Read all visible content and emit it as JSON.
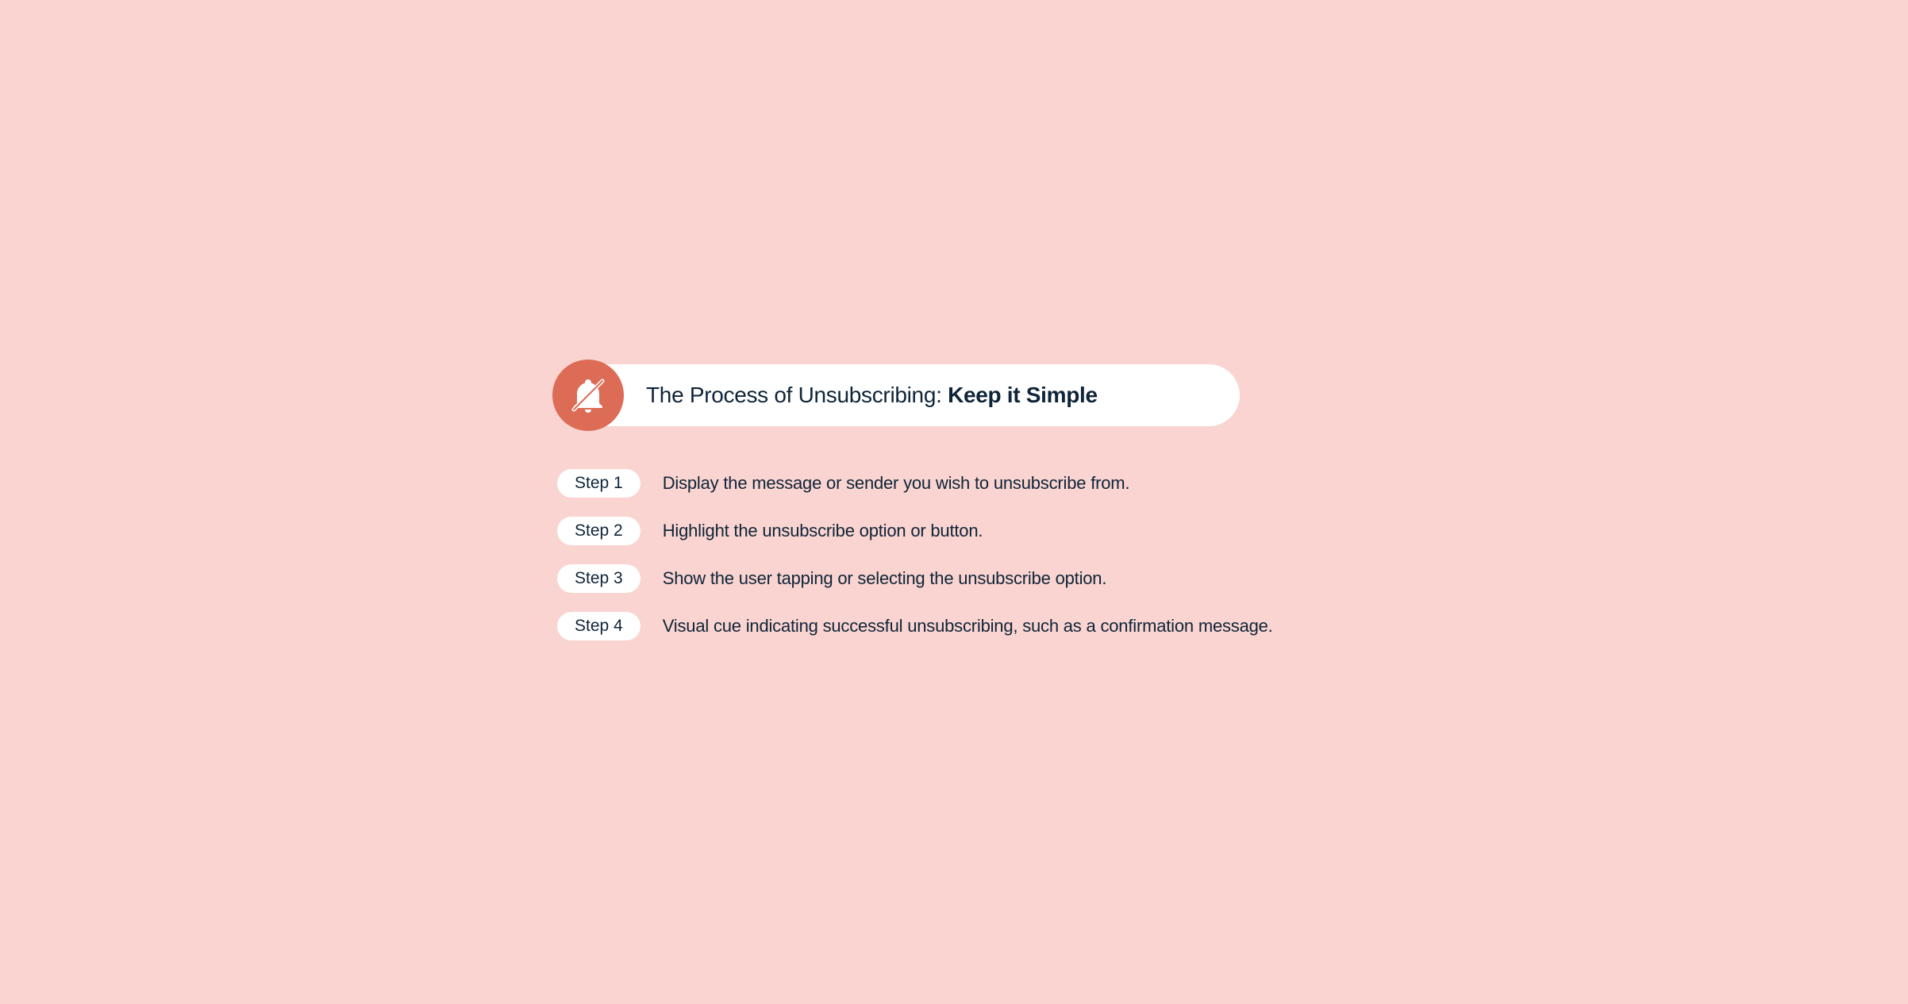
{
  "header": {
    "title_prefix": "The Process of Unsubscribing: ",
    "title_bold": "Keep it Simple",
    "icon": "bell-slash-icon"
  },
  "steps": [
    {
      "label": "Step 1",
      "text": "Display the message or sender you wish to unsubscribe from."
    },
    {
      "label": "Step 2",
      "text": "Highlight the unsubscribe option or button."
    },
    {
      "label": "Step 3",
      "text": "Show the user tapping or selecting the unsubscribe option."
    },
    {
      "label": "Step 4",
      "text": "Visual cue indicating successful unsubscribing, such as a confirmation message."
    }
  ],
  "colors": {
    "background": "#f9d4d0",
    "icon_bg": "#dc6c56",
    "text": "#0f2438",
    "pill_bg": "#ffffff"
  }
}
